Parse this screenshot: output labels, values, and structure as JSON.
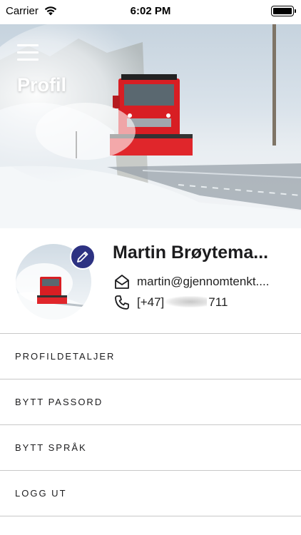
{
  "status_bar": {
    "carrier": "Carrier",
    "time": "6:02 PM",
    "battery_level": 1.0
  },
  "header": {
    "title": "Profil",
    "menu_icon": "hamburger-menu-icon"
  },
  "profile": {
    "name": "Martin Brøytema...",
    "email": "martin@gjennomtenkt....",
    "phone_prefix": "[+47]",
    "phone_suffix": "711",
    "edit_icon": "pencil-icon",
    "email_icon": "mail-open-icon",
    "phone_icon": "phone-icon",
    "accent_color": "#2d3282"
  },
  "menu": {
    "items": [
      {
        "label": "PROFILDETALJER"
      },
      {
        "label": "BYTT PASSORD"
      },
      {
        "label": "BYTT SPRÅK"
      },
      {
        "label": "LOGG UT"
      }
    ]
  }
}
